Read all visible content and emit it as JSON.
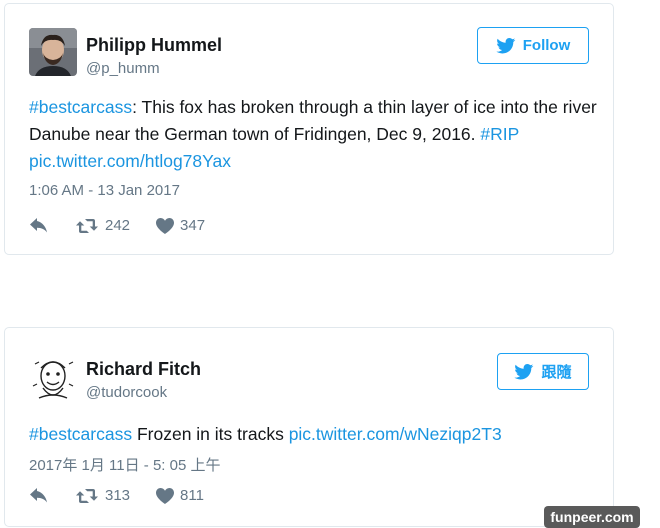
{
  "tweets": [
    {
      "name": "Philipp Hummel",
      "handle": "@p_humm",
      "follow_label": "Follow",
      "text_segments": [
        {
          "type": "hashtag",
          "text": "#bestcarcass"
        },
        {
          "type": "text",
          "text": ": This fox has broken through a thin layer of ice into the river Danube near the German town of Fridingen, Dec 9, 2016. "
        },
        {
          "type": "hashtag",
          "text": "#RIP"
        },
        {
          "type": "text",
          "text": " "
        },
        {
          "type": "link",
          "text": "pic.twitter.com/htlog78Yax"
        }
      ],
      "timestamp": "1:06 AM - 13 Jan 2017",
      "retweets": "242",
      "likes": "347"
    },
    {
      "name": "Richard Fitch",
      "handle": "@tudorcook",
      "follow_label": "跟隨",
      "text_segments": [
        {
          "type": "hashtag",
          "text": "#bestcarcass"
        },
        {
          "type": "text",
          "text": " Frozen in its tracks "
        },
        {
          "type": "link",
          "text": "pic.twitter.com/wNeziqp2T3"
        }
      ],
      "timestamp": "2017年 1月 11日 - 5: 05 上午",
      "retweets": "313",
      "likes": "811"
    }
  ],
  "watermark": "funpeer.com",
  "colors": {
    "link": "#1b95e0",
    "follow": "#1da1f2",
    "meta": "#657786",
    "border": "#e1e8ed"
  },
  "icons": [
    "twitter-bird-icon",
    "reply-icon",
    "retweet-icon",
    "heart-icon"
  ]
}
